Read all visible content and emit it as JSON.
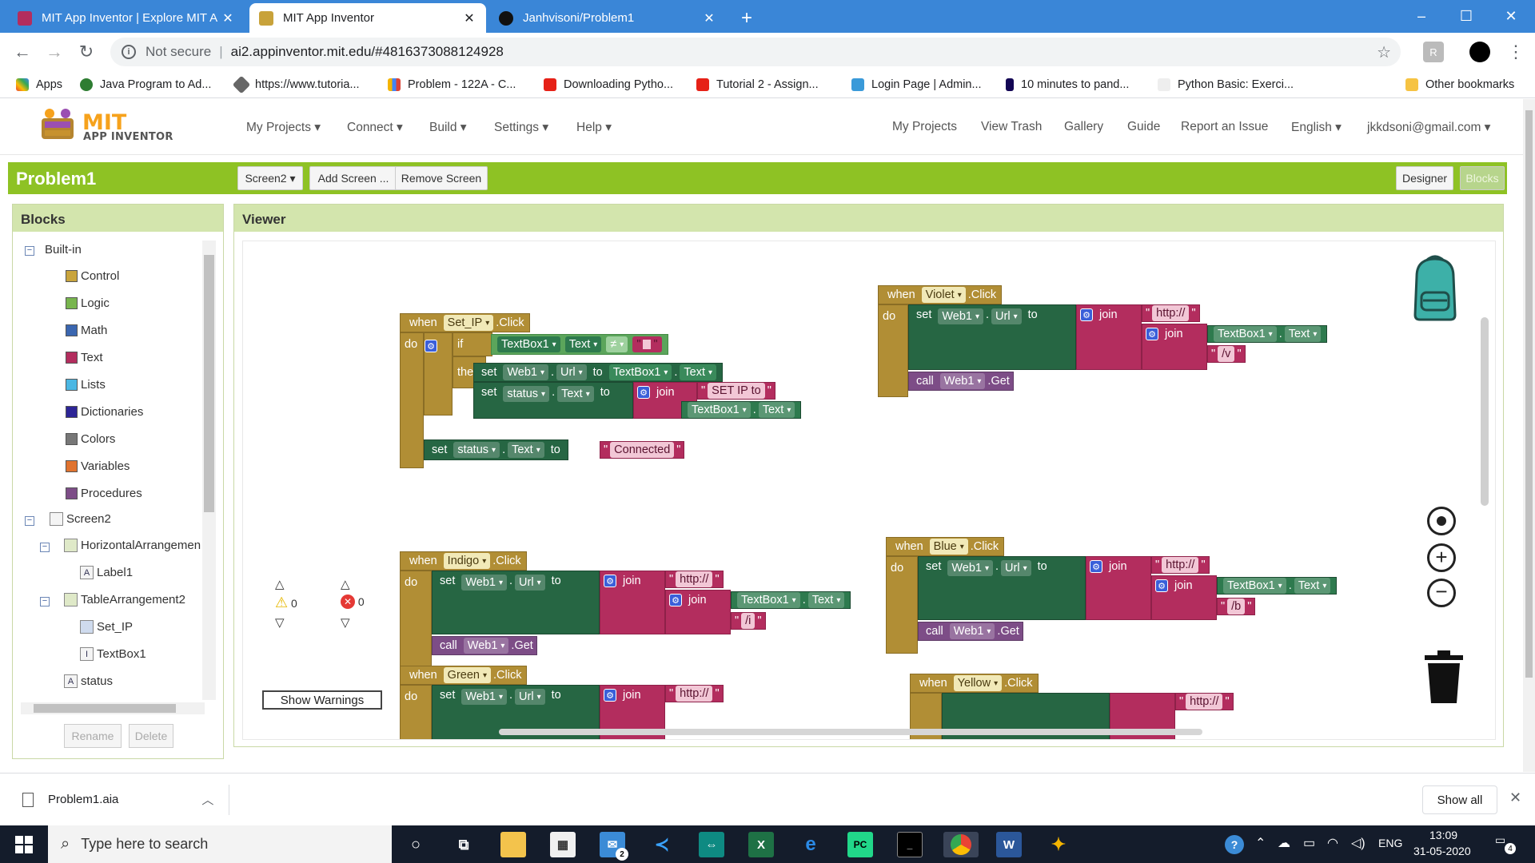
{
  "browser": {
    "tabs": [
      {
        "title": "MIT App Inventor | Explore MIT A",
        "active": false
      },
      {
        "title": "MIT App Inventor",
        "active": true
      },
      {
        "title": "Janhvisoni/Problem1",
        "active": false
      }
    ],
    "new_tab": "+",
    "window_controls": {
      "minimize": "–",
      "maximize": "☐",
      "close": "✕"
    },
    "security_label": "Not secure",
    "url": "ai2.appinventor.mit.edu/#4816373088124928",
    "bookmarks": [
      "Apps",
      "Java Program to Ad...",
      "https://www.tutoria...",
      "Problem - 122A - C...",
      "Downloading Pytho...",
      "Tutorial 2 - Assign...",
      "Login Page | Admin...",
      "10 minutes to pand...",
      "Python Basic: Exerci...",
      "Other bookmarks"
    ]
  },
  "app": {
    "logo_top": "MIT",
    "logo_bottom": "APP INVENTOR",
    "menus": [
      "My Projects",
      "Connect",
      "Build",
      "Settings",
      "Help"
    ],
    "right_links": [
      "My Projects",
      "View Trash",
      "Gallery",
      "Guide",
      "Report an Issue",
      "English",
      "jkkdsoni@gmail.com"
    ],
    "project_title": "Problem1",
    "screen_selector": "Screen2",
    "add_screen": "Add Screen ...",
    "remove_screen": "Remove Screen",
    "designer": "Designer",
    "blocks_btn": "Blocks"
  },
  "blocks_panel": {
    "title": "Blocks",
    "builtin": "Built-in",
    "categories": [
      {
        "label": "Control",
        "color": "#c9a43d"
      },
      {
        "label": "Logic",
        "color": "#78b54e"
      },
      {
        "label": "Math",
        "color": "#3a66b0"
      },
      {
        "label": "Text",
        "color": "#b32d5e"
      },
      {
        "label": "Lists",
        "color": "#4bb7e3"
      },
      {
        "label": "Dictionaries",
        "color": "#2d2596"
      },
      {
        "label": "Colors",
        "color": "#777777"
      },
      {
        "label": "Variables",
        "color": "#e0732f"
      },
      {
        "label": "Procedures",
        "color": "#7d4d87"
      }
    ],
    "screen": "Screen2",
    "components": [
      {
        "label": "HorizontalArrangemen"
      },
      {
        "label": "Label1"
      },
      {
        "label": "TableArrangement2"
      },
      {
        "label": "Set_IP"
      },
      {
        "label": "TextBox1"
      },
      {
        "label": "status"
      }
    ],
    "rename": "Rename",
    "delete": "Delete"
  },
  "viewer": {
    "title": "Viewer",
    "warnings_count": "0",
    "errors_count": "0",
    "show_warnings": "Show Warnings",
    "kw": {
      "when": "when",
      "do": "do",
      "set": "set",
      "to": "to",
      "join": "join",
      "call": "call",
      "if": "if",
      "then": "then",
      "click": ".Click",
      "get": ".Get",
      "neq": "≠",
      "dot": "."
    },
    "props": {
      "Web1": "Web1",
      "Url": "Url",
      "Text": "Text",
      "TextBox1": "TextBox1",
      "status": "status"
    },
    "set_ip": {
      "component": "Set_IP",
      "str_set_ip": "SET IP to",
      "str_connected": "Connected",
      "str_empty": ""
    },
    "violet": {
      "component": "Violet",
      "http": "http://",
      "path": "/v"
    },
    "indigo": {
      "component": "Indigo",
      "http": "http://",
      "path": "/i"
    },
    "blue": {
      "component": "Blue",
      "http": "http://",
      "path": "/b"
    },
    "green": {
      "component": "Green",
      "http": "http://"
    },
    "yellow": {
      "component": "Yellow",
      "http": "http://"
    }
  },
  "download": {
    "file": "Problem1.aia",
    "show_all": "Show all"
  },
  "taskbar": {
    "search_placeholder": "Type here to search",
    "lang": "ENG",
    "time": "13:09",
    "date": "31-05-2020",
    "mail_badge": "2",
    "notif_badge": "4"
  }
}
